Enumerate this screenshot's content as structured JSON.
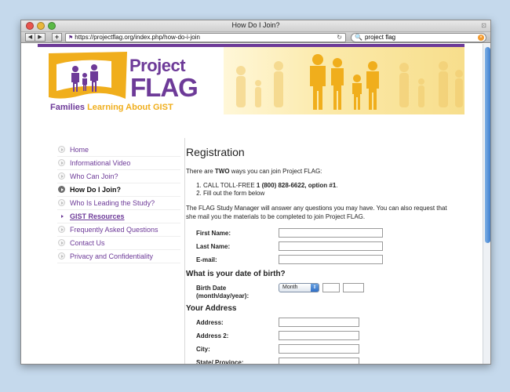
{
  "window": {
    "title": "How Do I Join?"
  },
  "toolbar": {
    "back": "◀",
    "forward": "▶",
    "add": "+",
    "url": "https://projectflag.org/index.php/how-do-i-join",
    "search_value": "project flag"
  },
  "logo": {
    "project": "Project",
    "flag": "FLAG",
    "tagline_a": "Families ",
    "tagline_b": "Learning About GIST"
  },
  "sidebar": {
    "items": [
      {
        "label": "Home"
      },
      {
        "label": "Informational Video"
      },
      {
        "label": "Who Can Join?"
      },
      {
        "label": "How Do I Join?"
      },
      {
        "label": "Who Is Leading the Study?"
      },
      {
        "label": "GIST Resources"
      },
      {
        "label": "Frequently Asked Questions"
      },
      {
        "label": "Contact Us"
      },
      {
        "label": "Privacy and Confidentiality"
      }
    ]
  },
  "main": {
    "title": "Registration",
    "intro_a": "There are ",
    "intro_b": "TWO",
    "intro_c": " ways you can join Project FLAG:",
    "steps": [
      {
        "pre": "CALL TOLL-FREE ",
        "bold": "1 (800) 828-6622, option #1",
        "post": "."
      },
      {
        "text": "Fill out the form below"
      }
    ],
    "paragraph": "The FLAG Study Manager will answer any questions you may have. You can also request that she mail you the materials to be completed to join Project FLAG.",
    "fields": {
      "first_name": "First Name:",
      "last_name": "Last Name:",
      "email": "E-mail:"
    },
    "dob_heading": "What is your date of birth?",
    "dob_label_1": "Birth Date",
    "dob_label_2": "(month/day/year):",
    "month_value": "Month",
    "address_heading": "Your Address",
    "address_fields": {
      "address": "Address:",
      "address2": "Address 2:",
      "city": "City:",
      "state": "State/ Province:"
    }
  }
}
